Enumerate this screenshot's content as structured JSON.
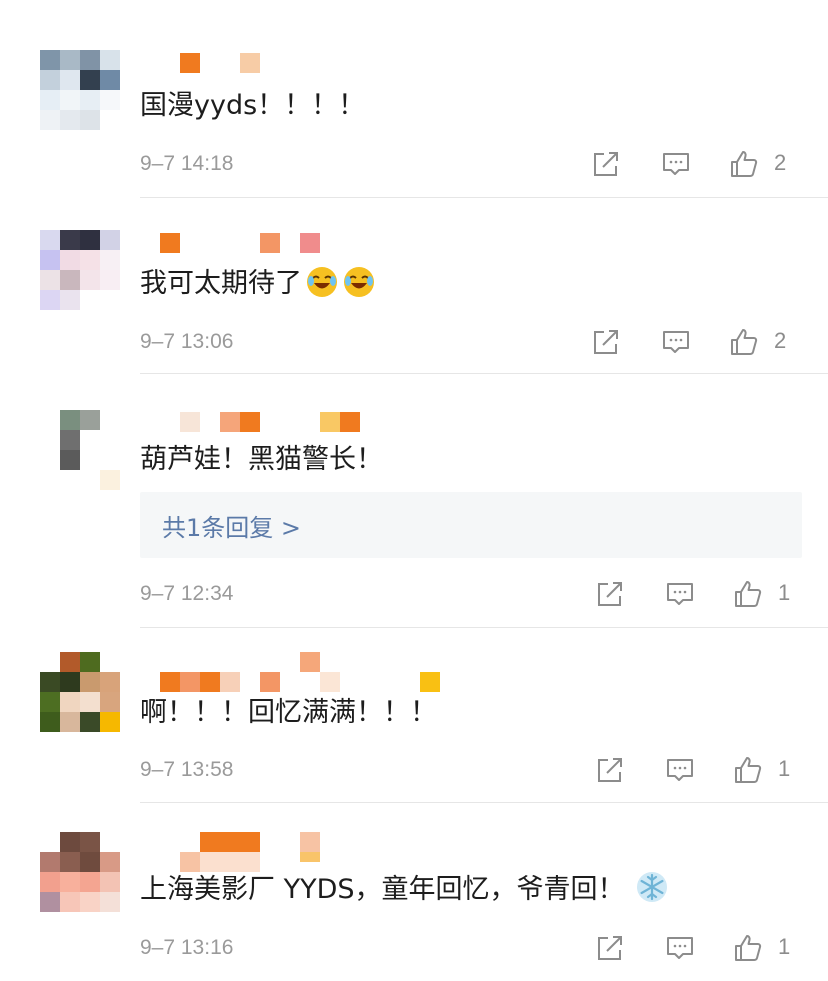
{
  "comments": [
    {
      "text": "国漫yyds！！！！",
      "date": "9–7 14:18",
      "likes": "2"
    },
    {
      "text": "我可太期待了",
      "date": "9–7 13:06",
      "likes": "2",
      "emoji": [
        "laugh-cry-emoji",
        "laugh-cry-emoji"
      ]
    },
    {
      "text": "葫芦娃！黑猫警长！",
      "date": "9–7 12:34",
      "likes": "1",
      "reply_link": "共1条回复 >"
    },
    {
      "text": "啊！！！回忆满满！！！",
      "date": "9–7 13:58",
      "likes": "1"
    },
    {
      "text": "上海美影厂 YYDS，童年回忆，爷青回！",
      "date": "9–7 13:16",
      "likes": "1",
      "emoji": [
        "snowflake-emoji"
      ]
    }
  ],
  "icons": {
    "share": "share-icon",
    "comment": "comment-icon",
    "like": "thumbs-up-icon"
  },
  "colors": {
    "link": "#5b7aa8",
    "meta": "#9a9a9a",
    "divider": "#e6e6e6",
    "reply_bg": "#f5f7f8"
  }
}
